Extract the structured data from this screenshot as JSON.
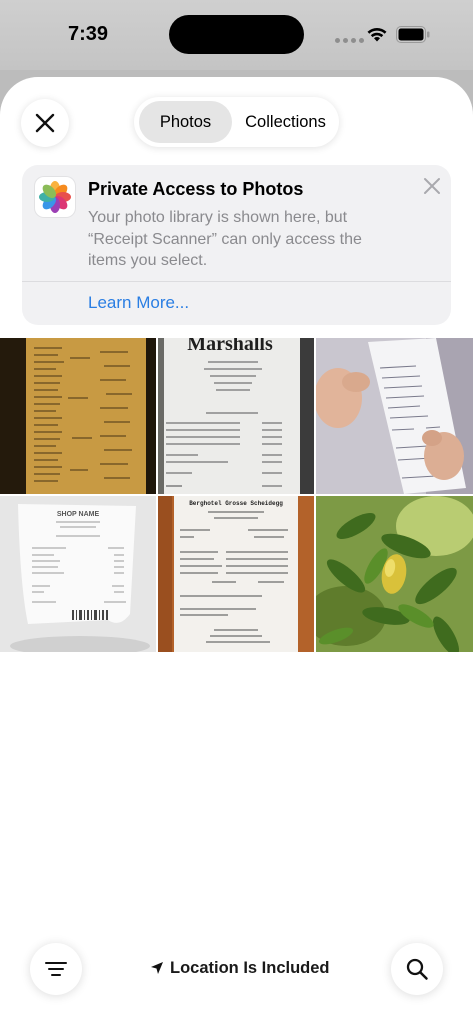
{
  "status_bar": {
    "time": "7:39"
  },
  "header": {
    "close_icon": "close-icon",
    "tabs": [
      {
        "label": "Photos",
        "selected": true
      },
      {
        "label": "Collections",
        "selected": false
      }
    ]
  },
  "banner": {
    "icon": "photos-app-icon",
    "title": "Private Access to Photos",
    "body": "Your photo library is shown here, but “Receipt Scanner” can only access the items you select.",
    "link": "Learn More...",
    "dismiss_icon": "close-icon"
  },
  "photos": [
    {
      "name": "receipt-long-yellow",
      "label": ""
    },
    {
      "name": "receipt-marshalls",
      "label": "Marshalls"
    },
    {
      "name": "receipt-hand-held",
      "label": ""
    },
    {
      "name": "receipt-cash-illustration",
      "label": "SHOP NAME"
    },
    {
      "name": "receipt-berghotel",
      "label": "Berghotel Grosse Scheidegg"
    },
    {
      "name": "lemon-tree",
      "label": ""
    }
  ],
  "bottom_bar": {
    "filter_icon": "filter-icon",
    "location_icon": "location-arrow-icon",
    "location_label": "Location Is Included",
    "search_icon": "search-icon"
  },
  "colors": {
    "accent": "#2a7ee3",
    "banner_bg": "#f1f1f3",
    "secondary_text": "#8a8a8e"
  }
}
